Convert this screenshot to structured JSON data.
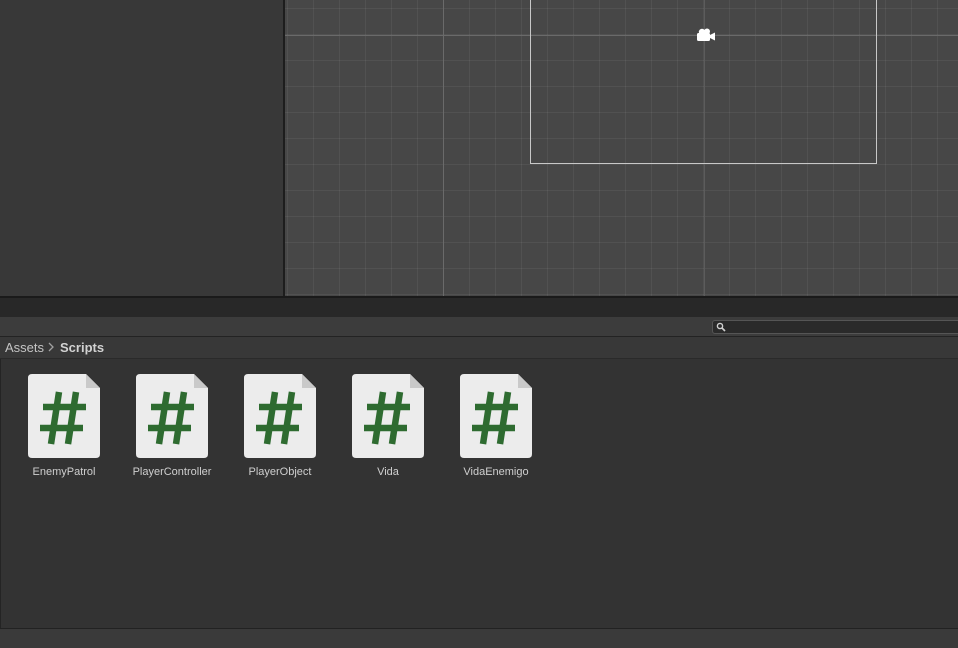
{
  "breadcrumb": {
    "root": "Assets",
    "current": "Scripts"
  },
  "search": {
    "placeholder": ""
  },
  "assets": [
    {
      "name": "EnemyPatrol",
      "icon": "csharp-script-icon"
    },
    {
      "name": "PlayerController",
      "icon": "csharp-script-icon"
    },
    {
      "name": "PlayerObject",
      "icon": "csharp-script-icon"
    },
    {
      "name": "Vida",
      "icon": "csharp-script-icon"
    },
    {
      "name": "VidaEnemigo",
      "icon": "csharp-script-icon"
    }
  ],
  "colors": {
    "script_icon_bg": "#ececec",
    "script_hash": "#2e6b30",
    "scene_bg": "#474747",
    "panel_bg": "#383838"
  }
}
